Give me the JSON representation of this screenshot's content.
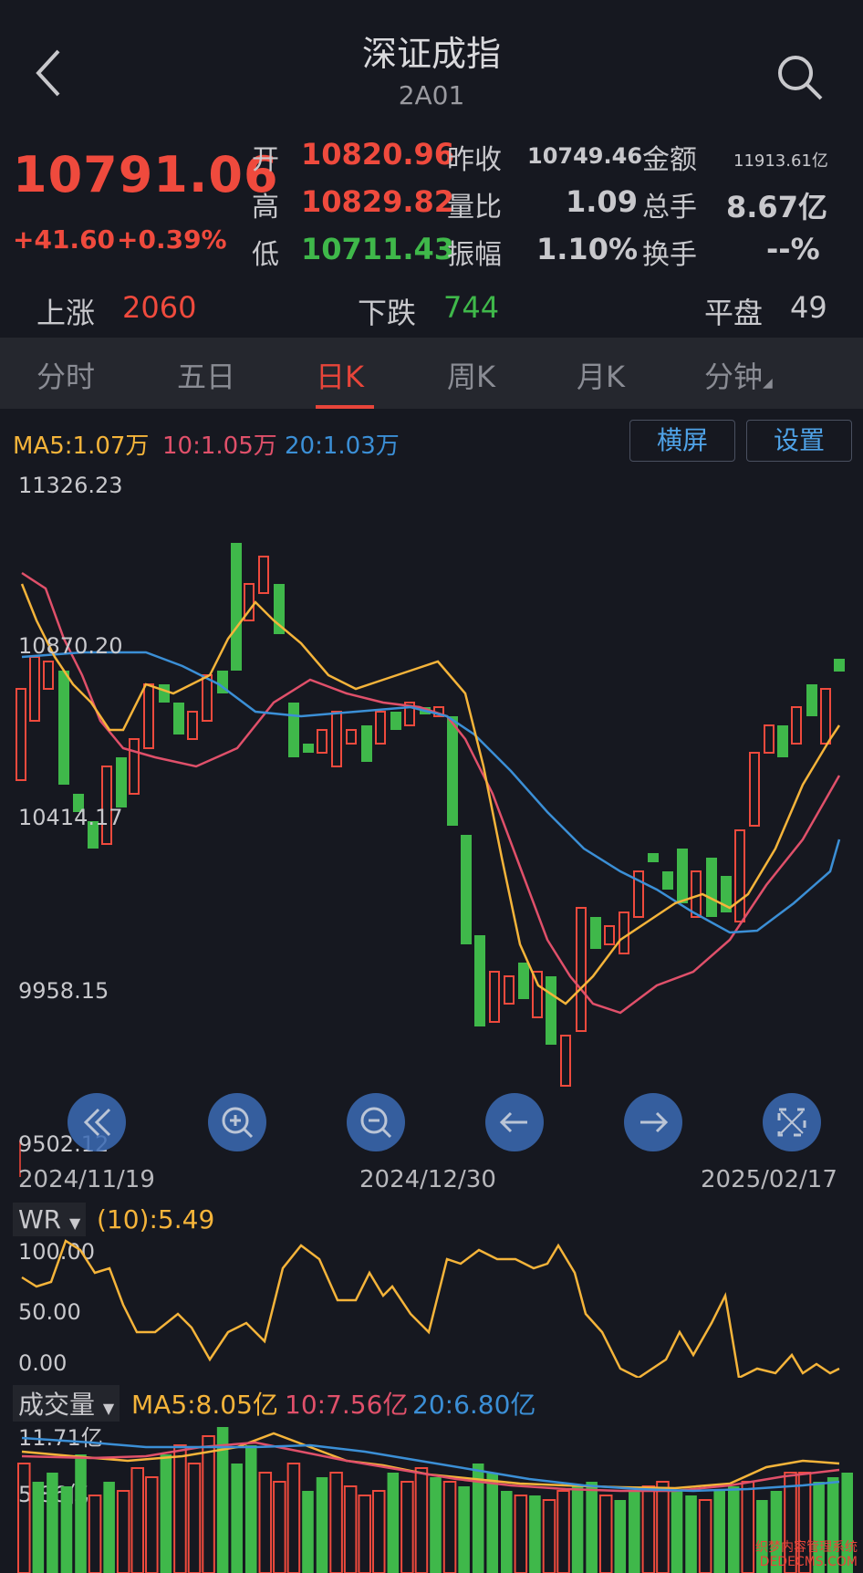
{
  "header": {
    "title": "深证成指",
    "code": "2A01"
  },
  "quote": {
    "price": "10791.06",
    "change": "+41.60",
    "change_pct": "+0.39%",
    "open_label": "开",
    "open": "10820.96",
    "high_label": "高",
    "high": "10829.82",
    "low_label": "低",
    "low": "10711.43",
    "prev_close_label": "昨收",
    "prev_close": "10749.46",
    "vol_ratio_label": "量比",
    "vol_ratio": "1.09",
    "amplitude_label": "振幅",
    "amplitude": "1.10%",
    "amount_label": "金额",
    "amount": "11913.61亿",
    "total_hands_label": "总手",
    "total_hands": "8.67亿",
    "turnover_label": "换手",
    "turnover": "--%"
  },
  "breadth": {
    "up_label": "上涨",
    "up": "2060",
    "down_label": "下跌",
    "down": "744",
    "flat_label": "平盘",
    "flat": "49"
  },
  "tabs": [
    {
      "label": "分时"
    },
    {
      "label": "五日"
    },
    {
      "label": "日K"
    },
    {
      "label": "周K"
    },
    {
      "label": "月K"
    },
    {
      "label": "分钟"
    }
  ],
  "ma_legend": {
    "ma5": "MA5:1.07万",
    "ma10": "10:1.05万",
    "ma20": "20:1.03万"
  },
  "buttons": {
    "landscape": "横屏",
    "settings": "设置"
  },
  "y_axis": [
    "11326.23",
    "10870.20",
    "10414.17",
    "9958.15",
    "9502.12"
  ],
  "x_axis": [
    "2024/11/19",
    "2024/12/30",
    "2025/02/17"
  ],
  "controls": [
    "rewind-icon",
    "zoom-in-icon",
    "zoom-out-icon",
    "left-arrow-icon",
    "right-arrow-icon",
    "fullscreen-icon"
  ],
  "wr": {
    "name": "WR",
    "value": "(10):5.49",
    "ticks": [
      "100.00",
      "50.00",
      "0.00"
    ]
  },
  "volume": {
    "name": "成交量",
    "ma5": "MA5:8.05亿",
    "ma10": "10:7.56亿",
    "ma20": "20:6.80亿",
    "ticks": [
      "11.71亿",
      "5.86亿"
    ]
  },
  "colors": {
    "up": "#ef4a3d",
    "down": "#3fb84a",
    "ma5": "#f5b43a",
    "ma10": "#e0506a",
    "ma20": "#3b8fd6",
    "accent": "#4fa3e8"
  },
  "watermark": {
    "line1": "织梦内容管理系统",
    "line2": "DEDECMS.COM"
  }
}
